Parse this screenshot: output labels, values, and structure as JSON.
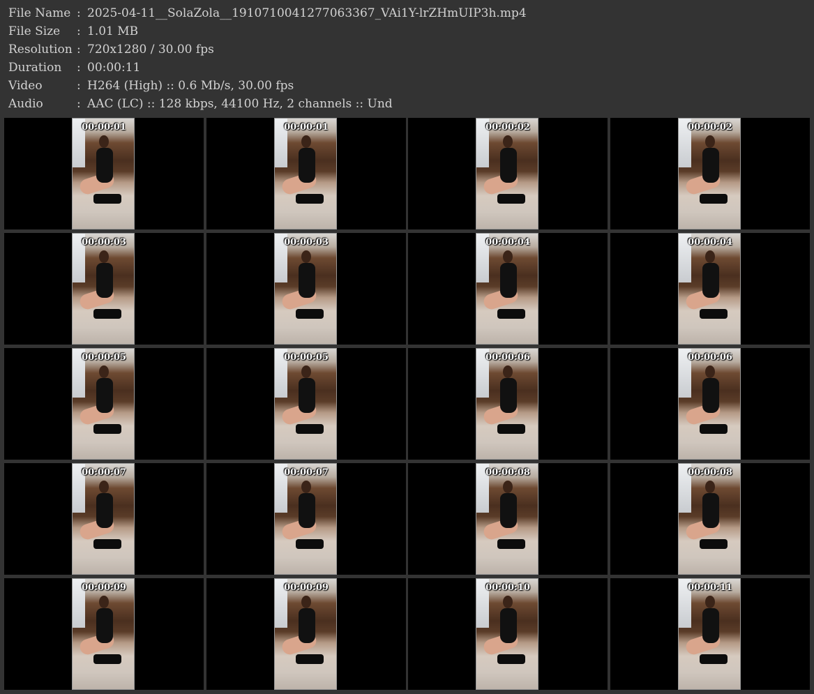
{
  "info": {
    "file_name": {
      "label": "File Name",
      "value": "2025-04-11__SolaZola__1910710041277063367_VAi1Y-lrZHmUIP3h.mp4"
    },
    "file_size": {
      "label": "File Size",
      "value": "1.01 MB"
    },
    "resolution": {
      "label": "Resolution",
      "value": "720x1280 / 30.00 fps"
    },
    "duration": {
      "label": "Duration",
      "value": "00:00:11"
    },
    "video": {
      "label": "Video",
      "value": "H264 (High) :: 0.6 Mb/s, 30.00 fps"
    },
    "audio": {
      "label": "Audio",
      "value": "AAC (LC) :: 128 kbps, 44100 Hz, 2 channels :: Und"
    },
    "separator": ":"
  },
  "thumbnails": [
    "00:00:01",
    "00:00:01",
    "00:00:02",
    "00:00:02",
    "00:00:03",
    "00:00:03",
    "00:00:04",
    "00:00:04",
    "00:00:05",
    "00:00:05",
    "00:00:06",
    "00:00:06",
    "00:00:07",
    "00:00:07",
    "00:00:08",
    "00:00:08",
    "00:00:09",
    "00:00:09",
    "00:00:10",
    "00:00:11"
  ],
  "colors": {
    "background": "#333333",
    "text": "#d2d2d2",
    "cell": "#000000",
    "timestamp": "#ffffff"
  }
}
